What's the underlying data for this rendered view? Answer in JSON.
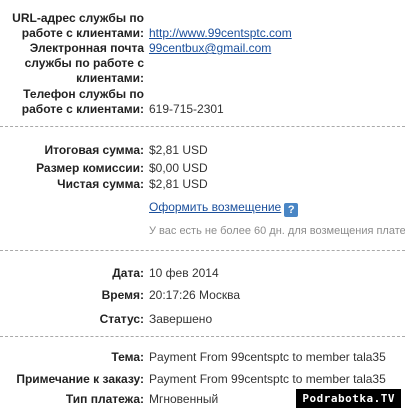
{
  "support": {
    "url_label_1": "URL-адрес службы по",
    "url_label_2": "работе с клиентами:",
    "url_value": "http://www.99centsptc.com",
    "email_label_1": "Электронная почта",
    "email_label_2": "службы по работе с",
    "email_label_3": "клиентами:",
    "email_value": "99centbux@gmail.com",
    "phone_label_1": "Телефон службы по",
    "phone_label_2": "работе с клиентами:",
    "phone_value": "619-715-2301"
  },
  "amounts": {
    "total_label": "Итоговая сумма:",
    "total_value": "$2,81 USD",
    "fee_label": "Размер комиссии:",
    "fee_value": "$0,00 USD",
    "net_label": "Чистая сумма:",
    "net_value": "$2,81 USD",
    "refund_link": "Оформить возмещение",
    "help_glyph": "?",
    "refund_note": "У вас есть не более 60 дн. для возмещения плате"
  },
  "details": {
    "date_label": "Дата:",
    "date_value": "10 фев 2014",
    "time_label": "Время:",
    "time_value": "20:17:26 Москва",
    "status_label": "Статус:",
    "status_value": "Завершено"
  },
  "order": {
    "subject_label": "Тема:",
    "subject_value": "Payment From 99centsptc to member tala35",
    "note_label": "Примечание к заказу:",
    "note_value": "Payment From 99centsptc to member tala35",
    "type_label": "Тип платежа:",
    "type_value": "Мгновенный"
  },
  "watermark": "Podrabotka.TV",
  "colors": {
    "link": "#1a4f9c",
    "help_badge": "#4a86c5",
    "separator": "#a9a9a9",
    "watermark_bg": "#000000"
  }
}
